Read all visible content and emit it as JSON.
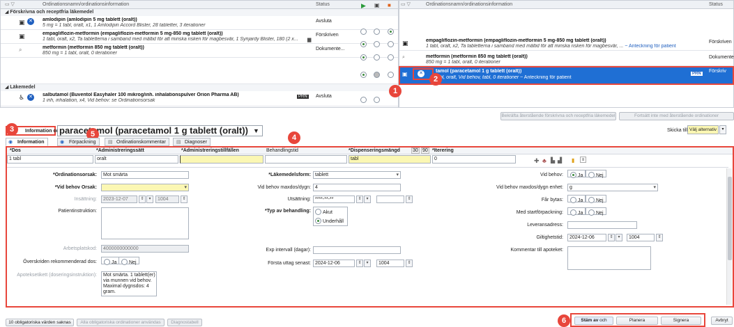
{
  "top_table": {
    "col_name": "Ordinationsnamn/ordinationsinformation",
    "col_status": "Status",
    "group1": "Förskrivna och receptfria läkemedel",
    "group2": "Läkemedel",
    "rows": [
      {
        "name": "amlodipin (amlodipin 5 mg tablett (oralt))",
        "sub": "5 mg = 1 tabl, oralt, x1, 1 Amlodipin Accord Blister, 28 tabletter, 3 iterationer",
        "status": "Avsluta"
      },
      {
        "name": "empagliflozin-metformin (empagliflozin-metformin 5 mg-850 mg tablett (oralt))",
        "sub": "1 tabl, oralt, x2, Ta tabletterna i samband med måltid för att minska risken för magbesvär, 1 Synjardy Blister, 180 (2 x...",
        "status": "Förskriven"
      },
      {
        "name": "metformin (metformin 850 mg tablett (oralt))",
        "sub": "850 mg = 1 tabl, oralt, 0 iterationer",
        "status": "Dokumente..."
      },
      {
        "name": "salbutamol (Buventol Easyhaler 100 mikrog/inh. inhalationspulver Orion Pharma AB)",
        "sub": "1 inh, inhalation, x4, Vid behov: se Ordinationsorsak",
        "status": "Avsluta",
        "badge": "PRN"
      }
    ]
  },
  "right_table": {
    "col_name": "Ordinationsnamn/ordinationsinformation",
    "col_status": "Status",
    "rows": [
      {
        "name": "empagliflozin-metformin (empagliflozin-metformin 5 mg-850 mg tablett (oralt))",
        "sub": "1 tabl, oralt, x2, Ta tabletterna i samband med måltid för att minska risken för magbesvär, ...",
        "link": "~ Anteckning för patient",
        "status": "Förskriven"
      },
      {
        "name": "metformin (metformin 850 mg tablett (oralt))",
        "sub": "850 mg = 1 tabl, oralt, 0 iterationer",
        "status": "Dokumente"
      },
      {
        "name": "tamol (paracetamol 1 g tablett (oralt))",
        "sub": "tabl, oralt, Vid behov, tabl, 0 iterationer",
        "link": "~ Anteckning för patient",
        "status": "Förskriv",
        "badge": "PRN"
      }
    ]
  },
  "actions": {
    "confirm": "Bekräfta återstående förskrivna och receptfria läkemedel",
    "continue": "Fortsätt inte med återstående ordinationer"
  },
  "order": {
    "info_label": "Information om",
    "title": "paracetamol (paracetamol 1 g tablett (oralt))",
    "send_to_label": "Skicka till:",
    "send_to_value": "Välj alternativ"
  },
  "tabs": [
    "Information",
    "Förpackning",
    "Ordinationskommentar",
    "Diagnoser"
  ],
  "dose_row": {
    "headers": {
      "dos": "*Dos",
      "adm": "*Administreringssätt",
      "tid": "*Administreringstillfällen",
      "beh": "Behandlingstid",
      "disp": "*Dispenseringsmängd",
      "b30": "30",
      "b90": "90",
      "iter": "*Iterering"
    },
    "values": {
      "dos": "1 tabl",
      "adm": "oralt",
      "tid": "",
      "beh": "",
      "disp": "tabl",
      "iter": "0"
    }
  },
  "form": {
    "ordinationsorsak_label": "*Ordinationsorsak:",
    "ordinationsorsak": "Mot smärta",
    "vidbehov_orsak_label": "*Vid behov Orsak:",
    "insattning_label": "Insättning:",
    "insattning_date": "2023-12-07",
    "insattning_time": "1004",
    "patientinstruktion_label": "Patientinstruktion:",
    "arbetsplatskod_label": "Arbetsplatskod:",
    "arbetsplatskod": "4000000000000",
    "overskriden_label": "Överskriden rekommenderad dos:",
    "ja": "Ja",
    "nej": "Nej",
    "apoteksetikett_label": "Apoteksetikett (doseringsinstruktion):",
    "apoteksetikett": "Mot smärta. 1 tablett(er) via munnen vid behov. Maximal dygnsdos: 4 gram.",
    "lakemedelsform_label": "*Läkemedelsform:",
    "lakemedelsform": "tablett",
    "maxdos_label": "Vid behov maxdos/dygn:",
    "maxdos": "4",
    "utsattning_label": "Utsättning:",
    "utsattning_date": "****-**-**",
    "typ_label": "*Typ av behandling:",
    "akut": "Akut",
    "underhall": "Underhåll",
    "exp_label": "Exp intervall (dagar):",
    "forsta_uttag_label": "Första uttag senast:",
    "forsta_uttag_date": "2024-12-06",
    "forsta_uttag_time": "1004",
    "vidbehov_label": "Vid behov:",
    "maxdos_enhet_label": "Vid behov maxdos/dygn enhet:",
    "maxdos_enhet": "g",
    "far_bytas_label": "Får bytas:",
    "startforpackning_label": "Med startförpackning:",
    "leveransadress_label": "Leveransadress:",
    "giltighetstid_label": "Giltighetstid:",
    "giltighetstid_date": "2024-12-06",
    "giltighetstid_time": "1004",
    "kommentar_label": "Kommentar till apoteket:"
  },
  "bottom": {
    "missing": "10 obligatoriska värden saknas",
    "attach": "Alla obligatoriska ordinationer användas",
    "diag": "Diagnostabell",
    "stam_av": "Stäm av",
    "och": "och",
    "planera": "Planera",
    "signera": "Signera",
    "avbryt": "Avbryt"
  },
  "callouts": [
    "1",
    "2",
    "3",
    "4",
    "5",
    "6"
  ],
  "colors": {
    "accent": "#1f5fbf",
    "callout": "#e8463b",
    "selected_row": "#1f6fd4",
    "yellow": "#fbf7b3"
  }
}
